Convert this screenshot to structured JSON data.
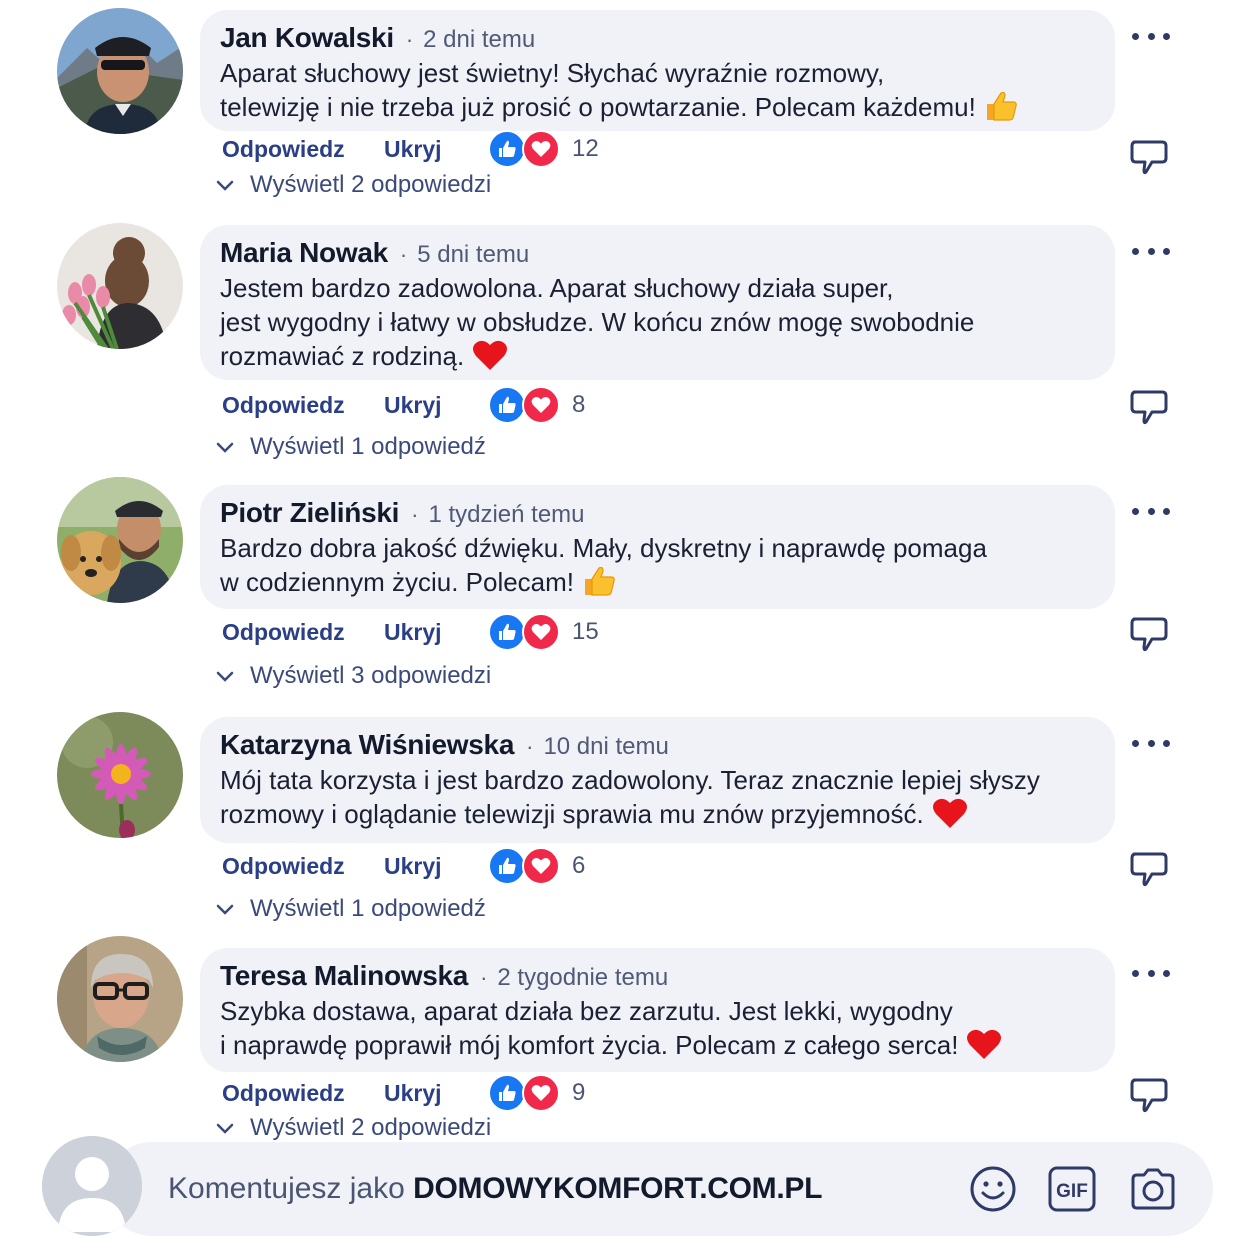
{
  "comments": [
    {
      "author": "Jan Kowalski",
      "time": "2 dni temu",
      "text": "Aparat słuchowy jest świetny! Słychać wyraźnie rozmowy,\ntelewizję i nie trzeba już prosić o powtarzanie. Polecam każdemu!",
      "emoji": "thumbs-up-emoji",
      "avatar": "man-with-sunglasses-mountains-avatar",
      "reply_label": "Odpowiedz",
      "hide_label": "Ukryj",
      "reactions": "12",
      "replies_label": "Wyświetl 2 odpowiedzi"
    },
    {
      "author": "Maria Nowak",
      "time": "5 dni temu",
      "text": "Jestem bardzo zadowolona. Aparat słuchowy działa super,\njest wygodny i łatwy w obsłudze. W końcu znów mogę swobodnie\nrozmawiać z rodziną.",
      "emoji": "red-heart-emoji",
      "avatar": "woman-with-tulips-avatar",
      "reply_label": "Odpowiedz",
      "hide_label": "Ukryj",
      "reactions": "8",
      "replies_label": "Wyświetl 1 odpowiedź"
    },
    {
      "author": "Piotr Zieliński",
      "time": "1 tydzień temu",
      "text": "Bardzo dobra jakość dźwięku. Mały, dyskretny i naprawdę pomaga\nw codziennym życiu. Polecam!",
      "emoji": "thumbs-up-emoji",
      "avatar": "man-with-dog-avatar",
      "reply_label": "Odpowiedz",
      "hide_label": "Ukryj",
      "reactions": "15",
      "replies_label": "Wyświetl 3 odpowiedzi"
    },
    {
      "author": "Katarzyna Wiśniewska",
      "time": "10 dni temu",
      "text": "Mój tata korzysta i jest bardzo zadowolony. Teraz znacznie lepiej słyszy\nrozmowy i oglądanie telewizji sprawia mu znów przyjemność.",
      "emoji": "red-heart-emoji",
      "avatar": "pink-flower-avatar",
      "reply_label": "Odpowiedz",
      "hide_label": "Ukryj",
      "reactions": "6",
      "replies_label": "Wyświetl 1 odpowiedź"
    },
    {
      "author": "Teresa Malinowska",
      "time": "2 tygodnie temu",
      "text": "Szybka dostawa, aparat działa bez zarzutu. Jest lekki, wygodny\ni naprawdę poprawił mój komfort życia. Polecam z całego serca!",
      "emoji": "red-heart-emoji",
      "avatar": "older-woman-glasses-avatar",
      "reply_label": "Odpowiedz",
      "hide_label": "Ukryj",
      "reactions": "9",
      "replies_label": "Wyświetl 2 odpowiedzi"
    }
  ],
  "composer": {
    "prefix": "Komentujesz jako",
    "account": "DOMOWYKOMFORT.COM.PL",
    "icons": [
      "smiley-icon",
      "gif-icon",
      "camera-icon"
    ]
  },
  "colors": {
    "bubble": "#f0f2f8",
    "action_text": "#2a3f86",
    "like": "#1877f2",
    "love": "#f02849"
  }
}
